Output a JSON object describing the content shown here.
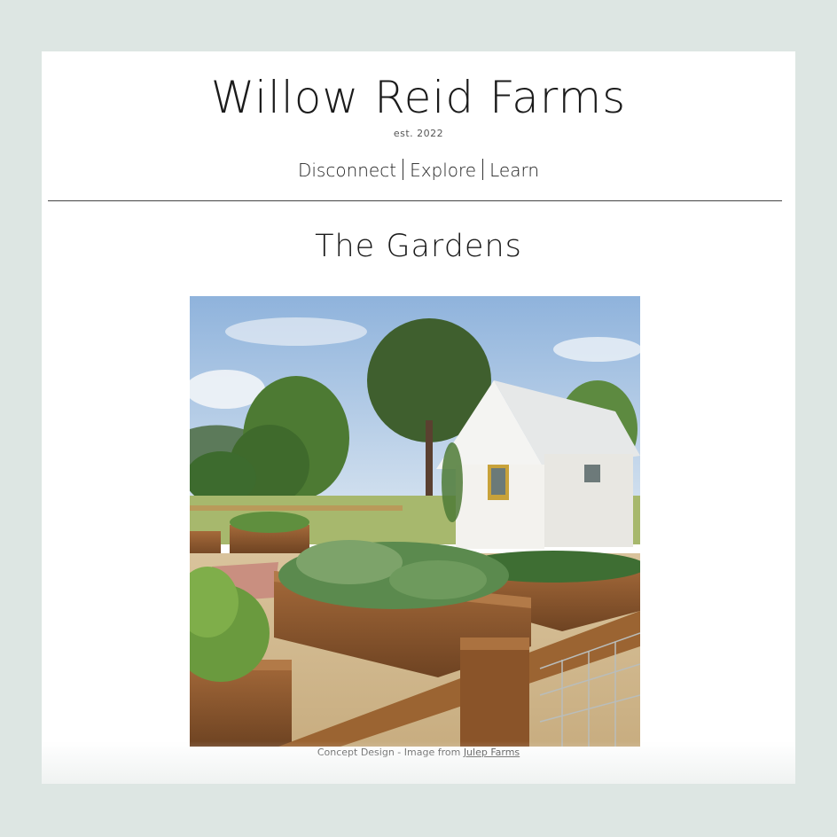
{
  "header": {
    "site_title": "Willow Reid Farms",
    "established": "est. 2022",
    "nav": [
      {
        "label": "Disconnect"
      },
      {
        "label": "Explore"
      },
      {
        "label": "Learn"
      }
    ]
  },
  "main": {
    "page_title": "The Gardens",
    "image": {
      "alt": "Raised wooden garden beds with a white cottage"
    },
    "caption": {
      "text": "Concept Design - Image from ",
      "link_label": "Julep Farms"
    }
  },
  "colors": {
    "background": "#dde6e3",
    "card": "#ffffff",
    "text": "#1b1b1b",
    "wood": "#8a5a33",
    "sky": "#a9c7e6",
    "foliage": "#4f7a3a"
  }
}
